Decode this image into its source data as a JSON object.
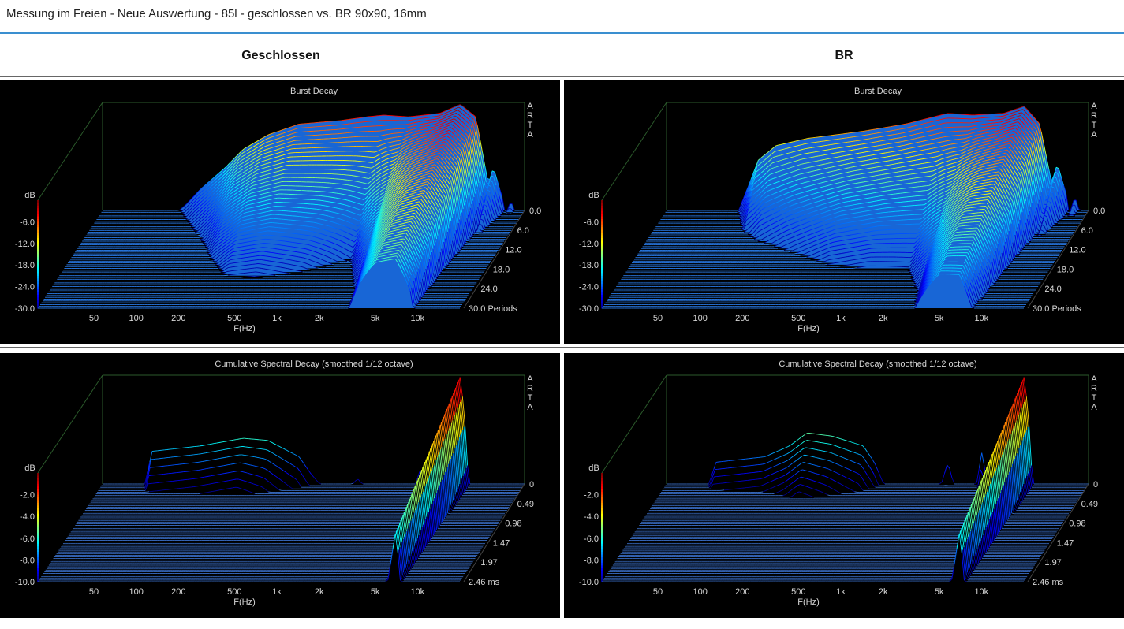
{
  "page": {
    "title": "Messung im Freien - Neue Auswertung - 85l - geschlossen vs. BR 90x90, 16mm",
    "columns": [
      "Geschlossen",
      "BR"
    ]
  },
  "chart_data": [
    {
      "type": "waterfall",
      "panel": "top-left",
      "title": "Burst Decay",
      "brand": [
        "A",
        "R",
        "T",
        "A"
      ],
      "xlabel": "F(Hz)",
      "xscale": "log",
      "xticks": [
        "50",
        "100",
        "200",
        "500",
        "1k",
        "2k",
        "5k",
        "10k"
      ],
      "xtick_values": [
        50,
        100,
        200,
        500,
        1000,
        2000,
        5000,
        10000
      ],
      "ylabel": "dB",
      "yticks": [
        "-6.0",
        "-12.0",
        "-18.0",
        "-24.0",
        "-30.0"
      ],
      "ytick_values": [
        -6,
        -12,
        -18,
        -24,
        -30
      ],
      "zticks": [
        "0.0",
        "6.0",
        "12.0",
        "18.0",
        "24.0",
        "30.0 Periods"
      ],
      "zunit": "Periods",
      "zrange": [
        0,
        30
      ],
      "slices": 55,
      "front_response": [
        [
          70,
          -30
        ],
        [
          80,
          -28
        ],
        [
          100,
          -24
        ],
        [
          150,
          -18
        ],
        [
          200,
          -13
        ],
        [
          300,
          -9
        ],
        [
          500,
          -6
        ],
        [
          1000,
          -5
        ],
        [
          1500,
          -4
        ],
        [
          2000,
          -3.5
        ],
        [
          3000,
          -4
        ],
        [
          5000,
          -3
        ],
        [
          7000,
          -0.5
        ],
        [
          9000,
          -4
        ],
        [
          12000,
          -30
        ]
      ],
      "decay_periods": [
        [
          100,
          8
        ],
        [
          300,
          10
        ],
        [
          1000,
          8
        ],
        [
          2000,
          6
        ],
        [
          3000,
          10
        ],
        [
          5000,
          22
        ],
        [
          7000,
          20
        ],
        [
          10000,
          12
        ]
      ],
      "secondary_peaks": [
        [
          12000,
          -18
        ],
        [
          16000,
          -27
        ]
      ]
    },
    {
      "type": "waterfall",
      "panel": "top-right",
      "title": "Burst Decay",
      "brand": [
        "A",
        "R",
        "T",
        "A"
      ],
      "xlabel": "F(Hz)",
      "xscale": "log",
      "xticks": [
        "50",
        "100",
        "200",
        "500",
        "1k",
        "2k",
        "5k",
        "10k"
      ],
      "xtick_values": [
        50,
        100,
        200,
        500,
        1000,
        2000,
        5000,
        10000
      ],
      "ylabel": "dB",
      "yticks": [
        "-6.0",
        "-12.0",
        "-18.0",
        "-24.0",
        "-30.0"
      ],
      "ytick_values": [
        -6,
        -12,
        -18,
        -24,
        -30
      ],
      "zticks": [
        "0.0",
        "6.0",
        "12.0",
        "18.0",
        "24.0",
        "30.0 Periods"
      ],
      "zunit": "Periods",
      "zrange": [
        0,
        30
      ],
      "slices": 55,
      "front_response": [
        [
          65,
          -30
        ],
        [
          75,
          -24
        ],
        [
          90,
          -16
        ],
        [
          120,
          -12
        ],
        [
          200,
          -10
        ],
        [
          500,
          -8
        ],
        [
          1000,
          -6
        ],
        [
          2000,
          -3
        ],
        [
          3000,
          -3.5
        ],
        [
          5000,
          -3
        ],
        [
          7000,
          -1
        ],
        [
          9000,
          -6
        ],
        [
          12000,
          -30
        ]
      ],
      "decay_periods": [
        [
          100,
          5
        ],
        [
          500,
          8
        ],
        [
          1000,
          8
        ],
        [
          2000,
          7
        ],
        [
          3000,
          10
        ],
        [
          5000,
          18
        ],
        [
          7000,
          16
        ],
        [
          10000,
          10
        ]
      ],
      "secondary_peaks": [
        [
          12000,
          -17
        ],
        [
          16000,
          -26
        ]
      ]
    },
    {
      "type": "waterfall",
      "panel": "bottom-left",
      "title": "Cumulative Spectral Decay (smoothed 1/12 octave)",
      "brand": [
        "A",
        "R",
        "T",
        "A"
      ],
      "xlabel": "F(Hz)",
      "xscale": "log",
      "xticks": [
        "50",
        "100",
        "200",
        "500",
        "1k",
        "2k",
        "5k",
        "10k"
      ],
      "xtick_values": [
        50,
        100,
        200,
        500,
        1000,
        2000,
        5000,
        10000
      ],
      "ylabel": "dB",
      "yticks": [
        "-2.0",
        "-4.0",
        "-6.0",
        "-8.0",
        "-10.0"
      ],
      "ytick_values": [
        -2,
        -4,
        -6,
        -8,
        -10
      ],
      "zticks": [
        "0",
        "0.49",
        "0.98",
        "1.47",
        "1.97",
        "2.46 ms"
      ],
      "zunit": "ms",
      "zrange": [
        0,
        2.46
      ],
      "slices": 60,
      "front_response": [
        [
          40,
          -10
        ],
        [
          45,
          -7
        ],
        [
          100,
          -6.5
        ],
        [
          200,
          -5.8
        ],
        [
          300,
          -6
        ],
        [
          500,
          -7.5
        ],
        [
          600,
          -9
        ],
        [
          700,
          -10
        ],
        [
          1200,
          -10
        ],
        [
          1300,
          -9.5
        ],
        [
          1400,
          -10
        ],
        [
          3400,
          -10
        ],
        [
          3600,
          -8.5
        ],
        [
          3800,
          -10
        ],
        [
          4500,
          -9
        ],
        [
          5500,
          -6
        ],
        [
          6500,
          -2
        ],
        [
          7000,
          0
        ],
        [
          7500,
          -4
        ],
        [
          8000,
          -10
        ]
      ],
      "decay_ms": [
        [
          200,
          0.35
        ],
        [
          1300,
          0.1
        ],
        [
          3600,
          0.15
        ],
        [
          7000,
          2.3
        ]
      ]
    },
    {
      "type": "waterfall",
      "panel": "bottom-right",
      "title": "Cumulative Spectral Decay (smoothed 1/12 octave)",
      "brand": [
        "A",
        "R",
        "T",
        "A"
      ],
      "xlabel": "F(Hz)",
      "xscale": "log",
      "xticks": [
        "50",
        "100",
        "200",
        "500",
        "1k",
        "2k",
        "5k",
        "10k"
      ],
      "xtick_values": [
        50,
        100,
        200,
        500,
        1000,
        2000,
        5000,
        10000
      ],
      "ylabel": "dB",
      "yticks": [
        "-2.0",
        "-4.0",
        "-6.0",
        "-8.0",
        "-10.0"
      ],
      "ytick_values": [
        -2,
        -4,
        -6,
        -8,
        -10
      ],
      "zticks": [
        "0",
        "0.49",
        "0.98",
        "1.47",
        "1.97",
        "2.46 ms"
      ],
      "zunit": "ms",
      "zrange": [
        0,
        2.46
      ],
      "slices": 60,
      "front_response": [
        [
          40,
          -10
        ],
        [
          45,
          -8
        ],
        [
          100,
          -7.5
        ],
        [
          150,
          -6.5
        ],
        [
          200,
          -5.3
        ],
        [
          300,
          -5.6
        ],
        [
          500,
          -6.5
        ],
        [
          600,
          -8
        ],
        [
          700,
          -10
        ],
        [
          1800,
          -10
        ],
        [
          2000,
          -8
        ],
        [
          2200,
          -10
        ],
        [
          3200,
          -10
        ],
        [
          3500,
          -7
        ],
        [
          3800,
          -10
        ],
        [
          4500,
          -9.5
        ],
        [
          5500,
          -6
        ],
        [
          6500,
          -2
        ],
        [
          7000,
          0
        ],
        [
          7500,
          -4
        ],
        [
          8000,
          -10
        ]
      ],
      "decay_ms": [
        [
          200,
          0.4
        ],
        [
          2000,
          0.12
        ],
        [
          3500,
          0.15
        ],
        [
          7000,
          2.3
        ]
      ]
    }
  ]
}
